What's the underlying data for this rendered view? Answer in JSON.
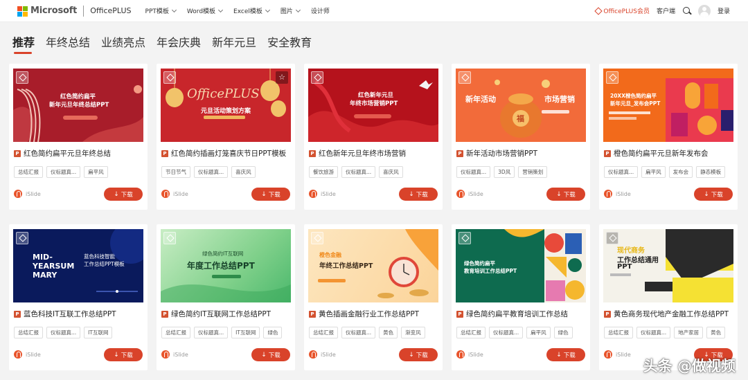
{
  "brand": {
    "name": "Microsoft",
    "product": "OfficePLUS"
  },
  "nav": [
    {
      "label": "PPT模板",
      "dropdown": true
    },
    {
      "label": "Word模板",
      "dropdown": true
    },
    {
      "label": "Excel模板",
      "dropdown": true
    },
    {
      "label": "图片",
      "dropdown": true
    },
    {
      "label": "设计师",
      "dropdown": false
    }
  ],
  "header_right": {
    "vip": "OfficePLUS会员",
    "client": "客户端",
    "login": "登录"
  },
  "tabs": [
    "推荐",
    "年终总结",
    "业绩亮点",
    "年会庆典",
    "新年元旦",
    "安全教育"
  ],
  "active_tab": 0,
  "download_label": "下载",
  "cards": [
    {
      "title": "红色简约扁平元旦年终总结",
      "tags": [
        "总结汇报",
        "仪标题真...",
        "扁平风"
      ],
      "author": "iSlide",
      "thumb": {
        "line1": "红色简约扁平",
        "line2": "新年元旦年终总结PPT"
      }
    },
    {
      "title": "红色简约插画灯笼喜庆节日PPT模板",
      "tags": [
        "节日节气",
        "仪标题真...",
        "喜庆风"
      ],
      "author": "iSlide",
      "thumb": {
        "script": "OfficePLUS",
        "line2": "元旦活动策划方案"
      }
    },
    {
      "title": "红色新年元旦年终市场营销",
      "tags": [
        "餐饮旅游",
        "仪标题真...",
        "喜庆风"
      ],
      "author": "iSlide",
      "thumb": {
        "line1": "红色新年元旦",
        "line2": "年终市场营销PPT"
      }
    },
    {
      "title": "新年活动市场营销PPT",
      "tags": [
        "仪标题真...",
        "3D风",
        "营销策划"
      ],
      "author": "iSlide",
      "thumb": {
        "left": "新年活动",
        "right": "市场营销",
        "coin": "福"
      }
    },
    {
      "title": "橙色简约扁平元旦新年发布会",
      "tags": [
        "仪标题真...",
        "扁平风",
        "发布会",
        "静态模板"
      ],
      "author": "iSlide",
      "thumb": {
        "line1": "20XX橙色简约扁平",
        "line2": "新年元旦_发布会PPT",
        "big": "2023"
      }
    },
    {
      "title": "蓝色科技IT互联工作总结PPT",
      "tags": [
        "总结汇报",
        "仪标题真...",
        "IT互联网"
      ],
      "author": "iSlide",
      "thumb": {
        "big1": "MID-",
        "big2": "YEARSUM",
        "big3": "MARY",
        "line1": "蓝色科技智能",
        "line2": "工作总结PPT模板"
      }
    },
    {
      "title": "绿色简约IT互联网工作总结PPT",
      "tags": [
        "总结汇报",
        "仪标题真...",
        "IT互联网",
        "绿色"
      ],
      "author": "iSlide",
      "thumb": {
        "line1": "绿色简约IT互联网",
        "line2": "年度工作总结PPT"
      }
    },
    {
      "title": "黄色插画金融行业工作总结PPT",
      "tags": [
        "总结汇报",
        "仪标题真...",
        "黄色",
        "渐变风"
      ],
      "author": "iSlide",
      "thumb": {
        "line1": "橙色金融",
        "line2": "年终工作总结PPT"
      }
    },
    {
      "title": "绿色简约扁平教育培训工作总结",
      "tags": [
        "总结汇报",
        "仪标题真...",
        "扁平风",
        "绿色"
      ],
      "author": "iSlide",
      "thumb": {
        "line1": "绿色简约扁平",
        "line2": "教育培训工作总结PPT"
      }
    },
    {
      "title": "黄色商务现代地产金融工作总结PPT",
      "tags": [
        "总结汇报",
        "仪标题真...",
        "地产家居",
        "黄色"
      ],
      "author": "iSlide",
      "thumb": {
        "line1": "现代商务",
        "line2": "工作总结通用",
        "line3": "PPT"
      }
    }
  ],
  "watermark": "头条 @做视频"
}
